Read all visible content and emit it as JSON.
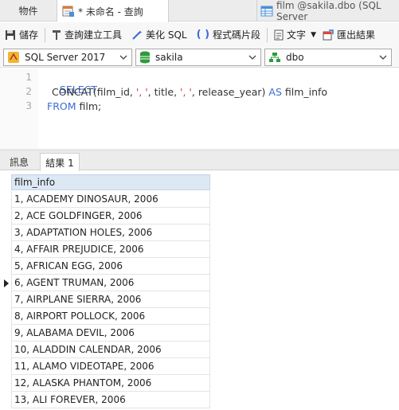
{
  "tabs": {
    "objects": "物件",
    "query": "* 未命名 - 查詢",
    "table": "film @sakila.dbo (SQL Server"
  },
  "toolbar": {
    "save": "儲存",
    "query_builder": "查詢建立工具",
    "beautify": "美化 SQL",
    "snippet": "程式碼片段",
    "text": "文字",
    "export": "匯出結果"
  },
  "selectors": {
    "connection": "SQL Server 2017",
    "database": "sakila",
    "schema": "dbo"
  },
  "editor": {
    "line_numbers": [
      "1",
      "2",
      "3"
    ],
    "line1": "SELECT",
    "line2": {
      "fn": "CONCAT(film_id, ",
      "s1": "', '",
      "mid1": ", title, ",
      "s2": "', '",
      "mid2": ", release_year) ",
      "as": "AS",
      "alias": " film_info"
    },
    "line3": {
      "from": "FROM",
      "table": " film;"
    }
  },
  "results": {
    "tab_messages": "訊息",
    "tab_result": "結果 1",
    "column": "film_info",
    "selected_row": 5,
    "rows": [
      "1, ACADEMY DINOSAUR, 2006",
      "2, ACE GOLDFINGER, 2006",
      "3, ADAPTATION HOLES, 2006",
      "4, AFFAIR PREJUDICE, 2006",
      "5, AFRICAN EGG, 2006",
      "6, AGENT TRUMAN, 2006",
      "7, AIRPLANE SIERRA, 2006",
      "8, AIRPORT POLLOCK, 2006",
      "9, ALABAMA DEVIL, 2006",
      "10, ALADDIN CALENDAR, 2006",
      "11, ALAMO VIDEOTAPE, 2006",
      "12, ALASKA PHANTOM, 2006",
      "13, ALI FOREVER, 2006"
    ]
  },
  "colors": {
    "keyword": "#3c6bd4",
    "string": "#d03838",
    "header_bg": "#dde8f5",
    "db_green": "#2e9b3a"
  }
}
